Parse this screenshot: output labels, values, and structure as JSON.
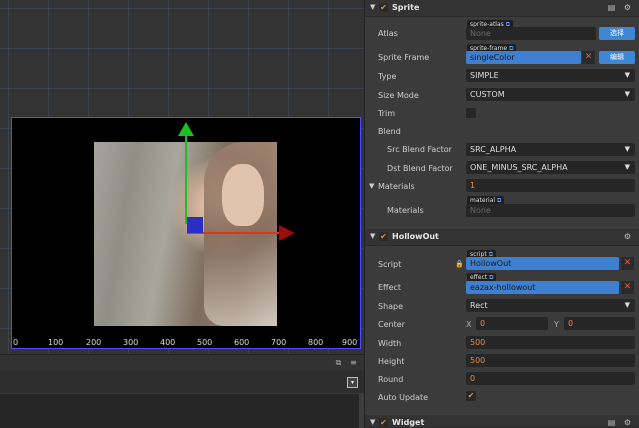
{
  "scene": {
    "ruler_ticks": [
      "0",
      "100",
      "200",
      "300",
      "400",
      "500",
      "600",
      "700",
      "800",
      "900"
    ],
    "colors": {
      "y_axis": "#19c21f",
      "x_axis": "#d23c1c",
      "canvas_border": "#4d4dff"
    }
  },
  "inspector": {
    "sprite": {
      "title": "Sprite",
      "atlas": {
        "label": "Atlas",
        "tag": "sprite-atlas",
        "placeholder": "None",
        "button": "选择"
      },
      "sprite_frame": {
        "label": "Sprite Frame",
        "tag": "sprite-frame",
        "value": "singleColor",
        "button": "编辑"
      },
      "type": {
        "label": "Type",
        "value": "SIMPLE"
      },
      "size_mode": {
        "label": "Size Mode",
        "value": "CUSTOM"
      },
      "trim": {
        "label": "Trim"
      },
      "blend": {
        "label": "Blend"
      },
      "src_blend": {
        "label": "Src Blend Factor",
        "value": "SRC_ALPHA"
      },
      "dst_blend": {
        "label": "Dst Blend Factor",
        "value": "ONE_MINUS_SRC_ALPHA"
      },
      "materials_count": {
        "label": "Materials",
        "value": "1"
      },
      "materials": {
        "label": "Materials",
        "tag": "material",
        "placeholder": "None"
      }
    },
    "hollowout": {
      "title": "HollowOut",
      "script": {
        "label": "Script",
        "tag": "script",
        "value": "HollowOut"
      },
      "effect": {
        "label": "Effect",
        "tag": "effect",
        "value": "eazax-hollowout"
      },
      "shape": {
        "label": "Shape",
        "value": "Rect"
      },
      "center": {
        "label": "Center",
        "x_label": "X",
        "x": "0",
        "y_label": "Y",
        "y": "0"
      },
      "width": {
        "label": "Width",
        "value": "500"
      },
      "height": {
        "label": "Height",
        "value": "500"
      },
      "round": {
        "label": "Round",
        "value": "0"
      },
      "auto_update": {
        "label": "Auto Update",
        "checked": true
      }
    },
    "widget": {
      "title": "Widget"
    }
  }
}
